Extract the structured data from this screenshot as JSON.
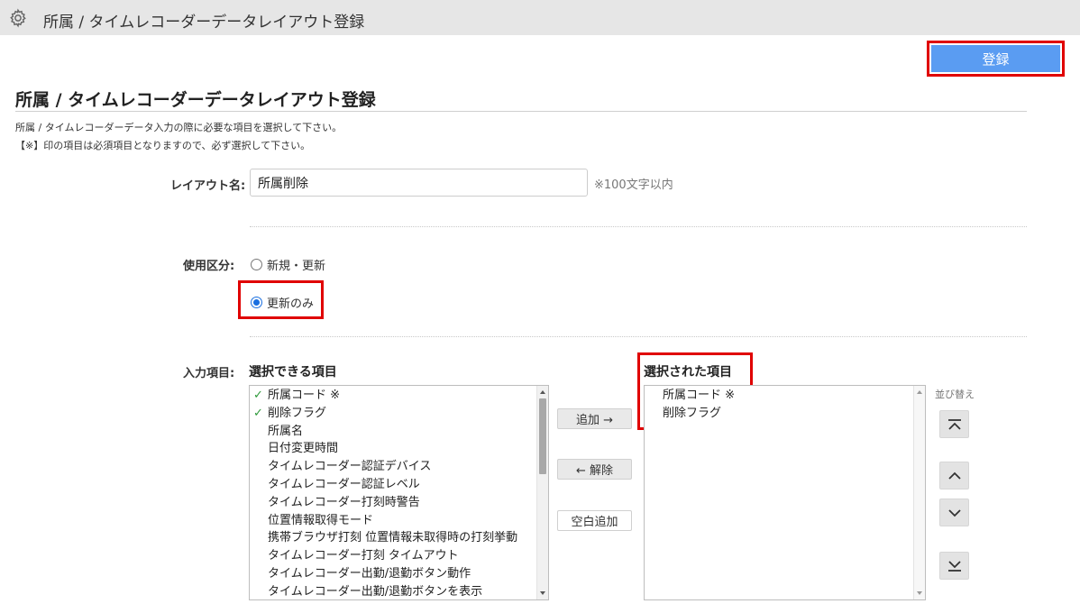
{
  "topbar": {
    "title": "所属 / タイムレコーダーデータレイアウト登録",
    "icon": "gear-icon"
  },
  "actions": {
    "register_label": "登録"
  },
  "page": {
    "title": "所属 / タイムレコーダーデータレイアウト登録",
    "description_line1": "所属 / タイムレコーダーデータ入力の際に必要な項目を選択して下さい。",
    "description_line2": "【※】印の項目は必須項目となりますので、必ず選択して下さい。"
  },
  "form": {
    "layout_name_label": "レイアウト名:",
    "layout_name_value": "所属削除",
    "layout_name_hint": "※100文字以内",
    "usage_label": "使用区分:",
    "usage_options": [
      {
        "label": "新規・更新",
        "checked": false
      },
      {
        "label": "更新のみ",
        "checked": true
      }
    ],
    "input_items_label": "入力項目:"
  },
  "available": {
    "heading": "選択できる項目",
    "items": [
      {
        "label": "所属コード ※",
        "selected": true
      },
      {
        "label": "削除フラグ",
        "selected": true
      },
      {
        "label": "所属名",
        "selected": false
      },
      {
        "label": "日付変更時間",
        "selected": false
      },
      {
        "label": "タイムレコーダー認証デバイス",
        "selected": false
      },
      {
        "label": "タイムレコーダー認証レベル",
        "selected": false
      },
      {
        "label": "タイムレコーダー打刻時警告",
        "selected": false
      },
      {
        "label": "位置情報取得モード",
        "selected": false
      },
      {
        "label": "携帯ブラウザ打刻 位置情報未取得時の打刻挙動",
        "selected": false
      },
      {
        "label": "タイムレコーダー打刻 タイムアウト",
        "selected": false
      },
      {
        "label": "タイムレコーダー出勤/退勤ボタン動作",
        "selected": false
      },
      {
        "label": "タイムレコーダー出勤/退勤ボタンを表示",
        "selected": false
      }
    ]
  },
  "buttons": {
    "add": "追加 →",
    "remove": "← 解除",
    "add_blank": "空白追加"
  },
  "selected": {
    "heading": "選択された項目",
    "items": [
      "所属コード ※",
      "削除フラグ"
    ]
  },
  "sort": {
    "label": "並び替え"
  },
  "colors": {
    "accent": "#5a9cf2",
    "highlight": "#e00000",
    "check": "#2e9a3a"
  }
}
